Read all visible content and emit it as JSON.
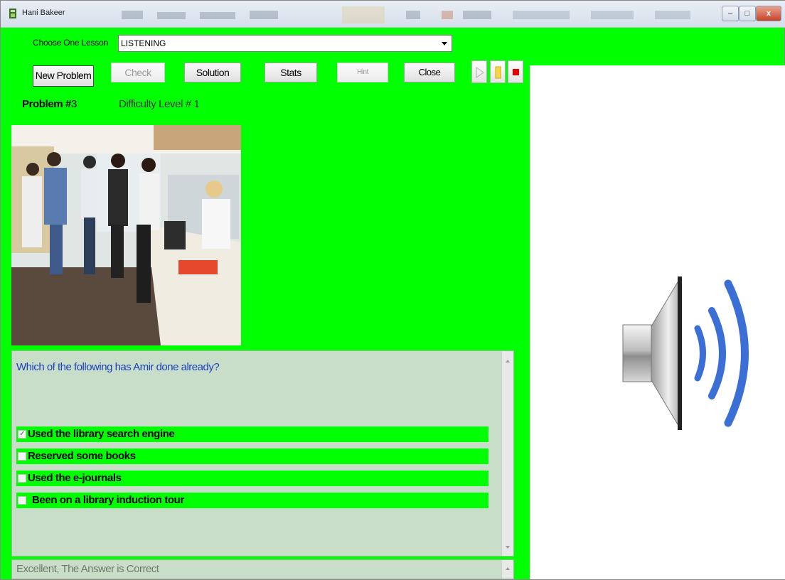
{
  "window": {
    "title": "Hani Bakeer",
    "controls": {
      "minimize": "–",
      "maximize": "□",
      "close": "x"
    }
  },
  "lesson": {
    "label": "Choose One Lesson",
    "selected": "LISTENING"
  },
  "toolbar": {
    "new_problem": "New Problem",
    "check": "Check",
    "solution": "Solution",
    "stats": "Stats",
    "hint": "Hint",
    "close": "Close"
  },
  "media": {
    "play_icon": "play-icon",
    "pause_icon": "pause-icon",
    "stop_icon": "stop-icon",
    "pause_color": "#e8b800",
    "stop_color": "#e00000"
  },
  "problem": {
    "label": "Problem #",
    "number": "3",
    "difficulty": "Difficulty Level # 1"
  },
  "question": {
    "text": "Which of the following has Amir done already?",
    "options": [
      {
        "label": "Used the library search engine",
        "checked": true
      },
      {
        "label": "Reserved some books",
        "checked": false
      },
      {
        "label": "Used the e-journals",
        "checked": false
      },
      {
        "label": "Been on a library induction tour",
        "checked": false
      }
    ]
  },
  "feedback": {
    "text": "Excellent, The Answer is Correct"
  },
  "colors": {
    "background": "#00ff00",
    "question_text": "#1a3fbf",
    "speaker_waves": "#3b6fd6"
  }
}
